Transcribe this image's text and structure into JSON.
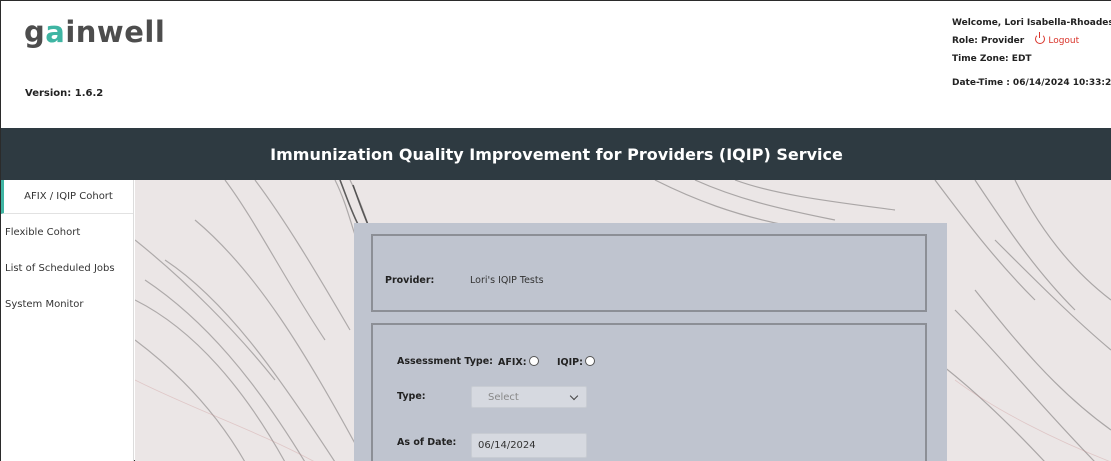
{
  "header": {
    "logo_text_a": "g",
    "logo_text_b": "a",
    "logo_text_c": "inwell",
    "version": "Version: 1.6.2",
    "welcome": "Welcome, Lori Isabella-Rhoades !",
    "role": "Role: Provider",
    "logout_label": "Logout",
    "timezone": "Time Zone: EDT",
    "datetime": "Date-Time :  06/14/2024 10:33:2"
  },
  "title": "Immunization Quality Improvement for Providers (IQIP) Service",
  "sidebar": {
    "items": [
      {
        "label": "AFIX / IQIP Cohort"
      },
      {
        "label": "Flexible Cohort"
      },
      {
        "label": "List of Scheduled Jobs"
      },
      {
        "label": "System Monitor"
      }
    ]
  },
  "form": {
    "provider_label": "Provider:",
    "provider_value": "Lori's IQIP Tests",
    "assessment_label": "Assessment Type:",
    "afix_label": "AFIX:",
    "iqip_label": "IQIP:",
    "type_label": "Type:",
    "type_value": "Select",
    "asof_label": "As of Date:",
    "asof_value": "06/14/2024"
  },
  "colors": {
    "brand_teal": "#3fb5a3",
    "titlebar": "#2e3a41",
    "logout_red": "#d9342b",
    "panel": "#bfc4cf"
  },
  "icons": [
    "power-icon",
    "chevron-down-icon"
  ]
}
